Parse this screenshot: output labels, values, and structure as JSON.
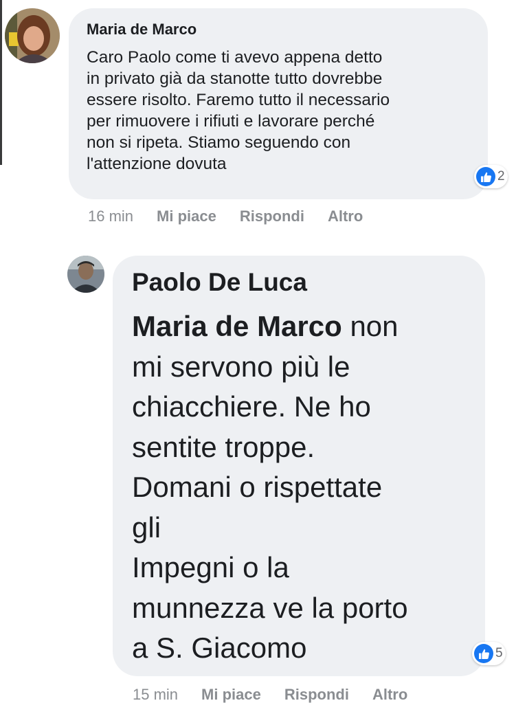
{
  "comments": [
    {
      "author": "Maria de Marco",
      "text": "Caro Paolo come ti avevo appena detto\nin privato già da stanotte tutto dovrebbe\nessere risolto. Faremo tutto il necessario\nper rimuovere i rifiuti e lavorare perché\nnon si ripeta. Stiamo seguendo con\nl'attenzione dovuta",
      "reaction_count": "2",
      "time": "16 min",
      "like_label": "Mi piace",
      "reply_label": "Rispondi",
      "more_label": "Altro"
    },
    {
      "author": "Paolo De Luca",
      "mention": "Maria de Marco",
      "text": " non\nmi servono più le\nchiacchiere. Ne ho\nsentite troppe.\nDomani o rispettate\ngli\nImpegni o la\nmunnezza ve la porto\na S. Giacomo",
      "reaction_count": "5",
      "time": "15 min",
      "like_label": "Mi piace",
      "reply_label": "Rispondi",
      "more_label": "Altro"
    }
  ],
  "icons": {
    "reaction": "like-thumbs-up-icon"
  },
  "colors": {
    "bubble": "#eef0f3",
    "like_blue": "#1877f2",
    "meta_text": "#8a8d91"
  }
}
